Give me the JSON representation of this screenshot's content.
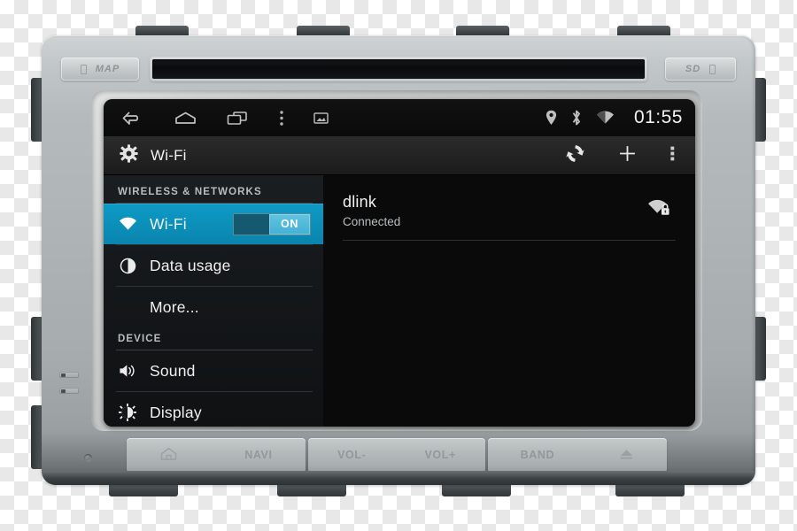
{
  "device": {
    "name": "car-head-unit",
    "slots": [
      {
        "id": "map-slot",
        "label": "MAP"
      },
      {
        "id": "sd-slot",
        "label": "SD"
      }
    ],
    "buttons": [
      {
        "id": "home",
        "label": "",
        "icon": "home-icon"
      },
      {
        "id": "navi",
        "label": "NAVI",
        "icon": ""
      },
      {
        "id": "vol-down",
        "label": "VOL-",
        "icon": ""
      },
      {
        "id": "vol-up",
        "label": "VOL+",
        "icon": ""
      },
      {
        "id": "band",
        "label": "BAND",
        "icon": ""
      },
      {
        "id": "eject",
        "label": "",
        "icon": "eject-icon"
      }
    ]
  },
  "screen": {
    "statusbar": {
      "nav_icons": [
        "back-icon",
        "home-icon",
        "recents-icon",
        "overflow-menu-icon",
        "screenshot-icon"
      ],
      "status_icons": [
        "location-pin-icon",
        "bluetooth-icon",
        "wifi-icon"
      ],
      "clock": "01:55"
    },
    "actionbar": {
      "icon": "settings-gear-icon",
      "title": "Wi-Fi",
      "actions": [
        "wps-scan-icon",
        "add-network-icon",
        "overflow-menu-icon"
      ]
    },
    "sidebar": {
      "sections": [
        {
          "header": "WIRELESS & NETWORKS",
          "items": [
            {
              "label": "Wi-Fi",
              "icon": "wifi-icon",
              "selected": true,
              "toggle": "ON",
              "indent": false
            },
            {
              "label": "Data usage",
              "icon": "data-usage-icon",
              "selected": false,
              "toggle": null,
              "indent": false
            },
            {
              "label": "More...",
              "icon": null,
              "selected": false,
              "toggle": null,
              "indent": true
            }
          ]
        },
        {
          "header": "DEVICE",
          "items": [
            {
              "label": "Sound",
              "icon": "sound-icon",
              "selected": false,
              "toggle": null,
              "indent": false
            },
            {
              "label": "Display",
              "icon": "display-brightness-icon",
              "selected": false,
              "toggle": null,
              "indent": false
            }
          ]
        }
      ]
    },
    "networks": [
      {
        "ssid": "dlink",
        "status": "Connected",
        "icon": "wifi-secured-icon"
      }
    ]
  },
  "colors": {
    "accent": "#0d93bd",
    "toggle_thumb": "#4fb7d8",
    "screen_bg": "#0a0a0a",
    "chassis": "#aeb3b5"
  }
}
